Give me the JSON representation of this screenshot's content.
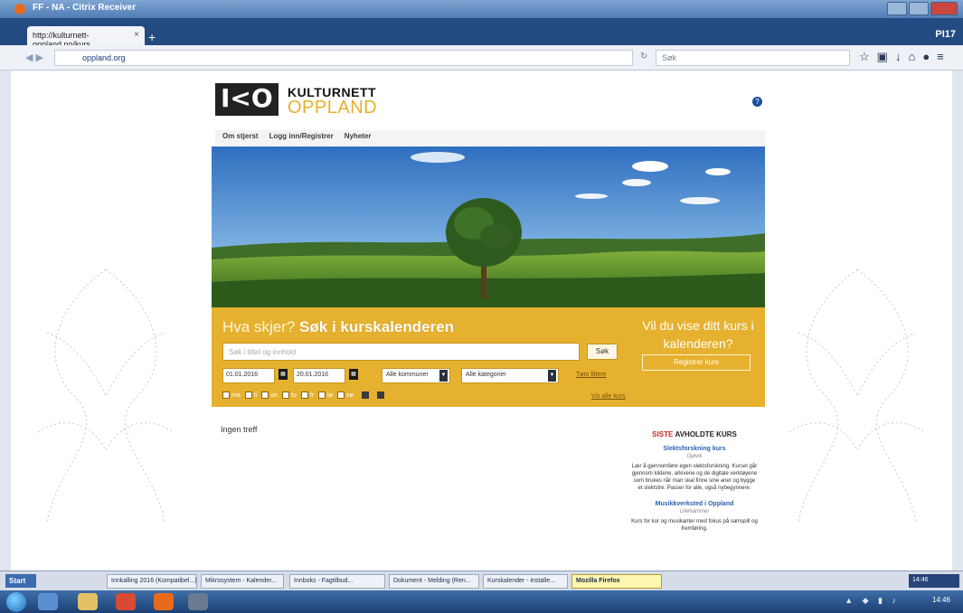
{
  "window": {
    "title": "FF - NA - Citrix Receiver",
    "corner_label": "PI17"
  },
  "browser": {
    "tab_title": "http://kulturnett-oppland.no/kurs",
    "url": "oppland.org",
    "search_placeholder": "Søk",
    "new_tab": "+",
    "tab_close": "×"
  },
  "site": {
    "logo_letters": "I<O",
    "logo_line1": "KULTURNETT",
    "logo_line2": "OPPLAND",
    "nav": [
      "Om stjerst",
      "Logg inn/Registrer",
      "Nyheter"
    ]
  },
  "search": {
    "heading_light": "Hva skjer?",
    "heading_bold": "Søk i kurskalenderen",
    "input_placeholder": "Søk i tittel og innhold",
    "search_button": "Søk",
    "date_from": "01.01.2016",
    "date_to": "20.01.2016",
    "select_municipality": "Alle kommuner",
    "select_category": "Alle kategorier",
    "link_clear": "Tøm filtere",
    "link_more": "Vis alle kurs",
    "checkboxes": [
      "ma",
      "ti",
      "on",
      "to",
      "fr",
      "lø",
      "sø"
    ],
    "cta_title": "Vil du vise ditt kurs i kalenderen?",
    "cta_button": "Registrer kurs"
  },
  "main": {
    "no_hits": "Ingen treff"
  },
  "sidebar": {
    "heading_prefix": "SISTE",
    "heading_rest": "AVHOLDTE KURS",
    "courses": [
      {
        "title": "Slektsforskning kurs",
        "meta": "Gjøvik",
        "text": "Lær å gjennomføre egen slektsforskning. Kurset går gjennom kildene, arkivene og de digitale verktøyene som brukes når man skal finne sine aner og bygge et slektstre. Passer for alle, også nybegynnere."
      },
      {
        "title": "Musikkverksted i Oppland",
        "meta": "Lillehammer",
        "text": "Kurs for kor og musikanter med fokus på samspill og fremføring."
      }
    ]
  },
  "taskbar": {
    "start": "Start",
    "items": [
      "Innkalling 2016 (Kompatibel...)",
      "Mikrosystem - Kalender...",
      "Innboks - Fagtilbud...",
      "Dokument - Melding (Ren...",
      "Kurskalender - installe...",
      "Mozilla Firefox"
    ],
    "tray_time": "14:46",
    "clock": "14:46"
  },
  "colors": {
    "panel": "#e6b12e",
    "logo_accent": "#e7b02a",
    "link_blue": "#2b5fb0",
    "heading_red": "#c72b1d"
  }
}
